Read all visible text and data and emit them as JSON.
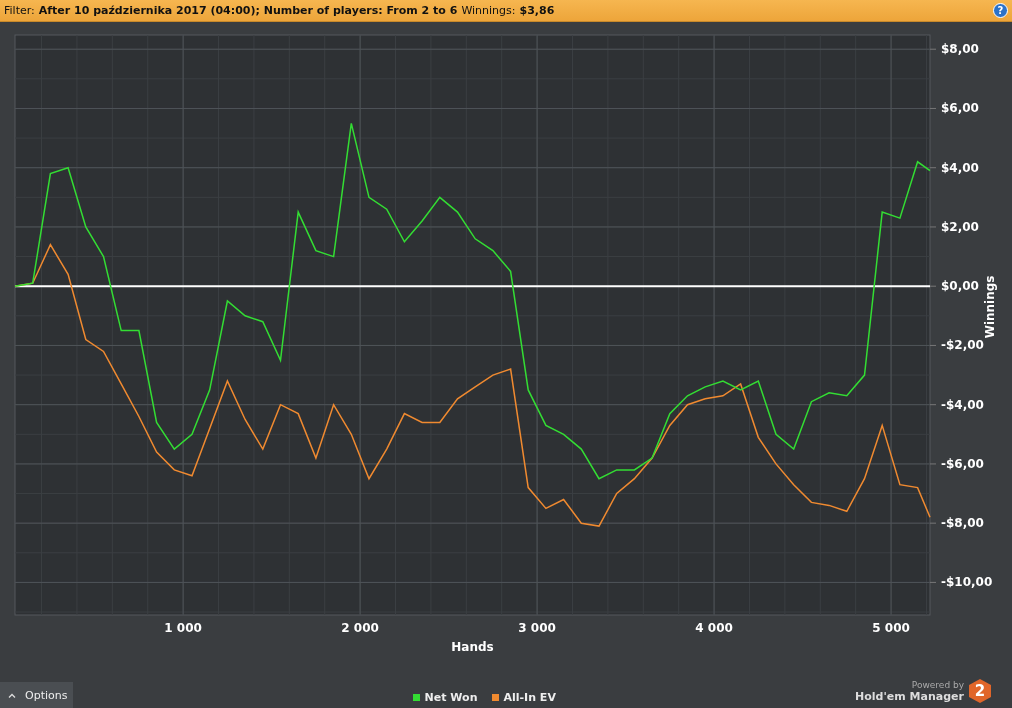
{
  "filter_bar": {
    "filter_label": "Filter:",
    "filter_value": "After 10 października 2017 (04:00); Number of players: From 2 to 6",
    "winnings_label": "Winnings:",
    "winnings_value": "$3,86",
    "help": "?"
  },
  "chart": {
    "chart_data": {
      "type": "line",
      "grid": true,
      "xlabel": "Hands",
      "ylabel": "Winnings",
      "xlim": [
        50,
        5220
      ],
      "ylim": [
        -11.1,
        8.48
      ],
      "xticks": [
        {
          "value": 1000,
          "label": "1 000"
        },
        {
          "value": 2000,
          "label": "2 000"
        },
        {
          "value": 3000,
          "label": "3 000"
        },
        {
          "value": 4000,
          "label": "4 000"
        },
        {
          "value": 5000,
          "label": "5 000"
        }
      ],
      "yticks": [
        {
          "value": 8,
          "label": "$8,00"
        },
        {
          "value": 6,
          "label": "$6,00"
        },
        {
          "value": 4,
          "label": "$4,00"
        },
        {
          "value": 2,
          "label": "$2,00"
        },
        {
          "value": 0,
          "label": "$0,00"
        },
        {
          "value": -2,
          "label": "-$2,00"
        },
        {
          "value": -4,
          "label": "-$4,00"
        },
        {
          "value": -6,
          "label": "-$6,00"
        },
        {
          "value": -8,
          "label": "-$8,00"
        },
        {
          "value": -10,
          "label": "-$10,00"
        }
      ],
      "x": [
        50,
        150,
        250,
        350,
        450,
        550,
        650,
        750,
        850,
        950,
        1050,
        1150,
        1250,
        1350,
        1450,
        1550,
        1650,
        1750,
        1850,
        1950,
        2050,
        2150,
        2250,
        2350,
        2450,
        2550,
        2650,
        2750,
        2850,
        2950,
        3050,
        3150,
        3250,
        3350,
        3450,
        3550,
        3650,
        3750,
        3850,
        3950,
        4050,
        4150,
        4250,
        4350,
        4450,
        4550,
        4650,
        4750,
        4850,
        4950,
        5050,
        5150,
        5220
      ],
      "series": [
        {
          "name": "Net Won",
          "color": "#33dd33",
          "values": [
            0,
            0.1,
            3.8,
            4.0,
            2.0,
            1.0,
            -1.5,
            -1.5,
            -4.6,
            -5.5,
            -5.0,
            -3.5,
            -0.5,
            -1.0,
            -1.2,
            -2.5,
            2.5,
            1.2,
            1.0,
            5.5,
            3.0,
            2.6,
            1.5,
            2.2,
            3.0,
            2.5,
            1.6,
            1.2,
            0.5,
            -3.5,
            -4.7,
            -5.0,
            -5.5,
            -6.5,
            -6.2,
            -6.2,
            -5.8,
            -4.3,
            -3.7,
            -3.4,
            -3.2,
            -3.5,
            -3.2,
            -5.0,
            -5.5,
            -3.9,
            -3.6,
            -3.7,
            -3.0,
            2.5,
            2.3,
            4.2,
            3.9
          ]
        },
        {
          "name": "All-In EV",
          "color": "#f08a30",
          "values": [
            0,
            0.1,
            1.4,
            0.4,
            -1.8,
            -2.2,
            -3.3,
            -4.4,
            -5.6,
            -6.2,
            -6.4,
            -4.8,
            -3.2,
            -4.5,
            -5.5,
            -4.0,
            -4.3,
            -5.8,
            -4.0,
            -5.0,
            -6.5,
            -5.5,
            -4.3,
            -4.6,
            -4.6,
            -3.8,
            -3.4,
            -3.0,
            -2.8,
            -6.8,
            -7.5,
            -7.2,
            -8.0,
            -8.1,
            -7.0,
            -6.5,
            -5.8,
            -4.7,
            -4.0,
            -3.8,
            -3.7,
            -3.3,
            -5.1,
            -6.0,
            -6.7,
            -7.3,
            -7.4,
            -7.6,
            -6.5,
            -4.7,
            -6.7,
            -6.8,
            -7.8
          ]
        }
      ]
    }
  },
  "footer": {
    "options_button": "Options",
    "powered_by": "Powered by",
    "brand": "Hold'em Manager",
    "brand_badge": "2"
  }
}
